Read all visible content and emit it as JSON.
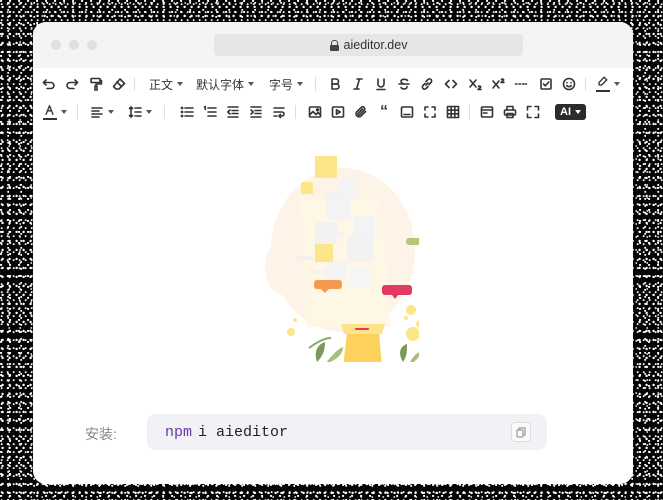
{
  "browser": {
    "url": "aieditor.dev"
  },
  "toolbar": {
    "paragraph": "正文",
    "font_family": "默认字体",
    "font_size": "字号",
    "ai_label": "AI"
  },
  "install": {
    "label": "安装:",
    "command_prefix": "npm",
    "command_rest": "i aieditor"
  },
  "colors": {
    "accent": "#6a35a8",
    "window_bg": "#ffffff",
    "titlebar_bg": "#f4f4f6"
  }
}
